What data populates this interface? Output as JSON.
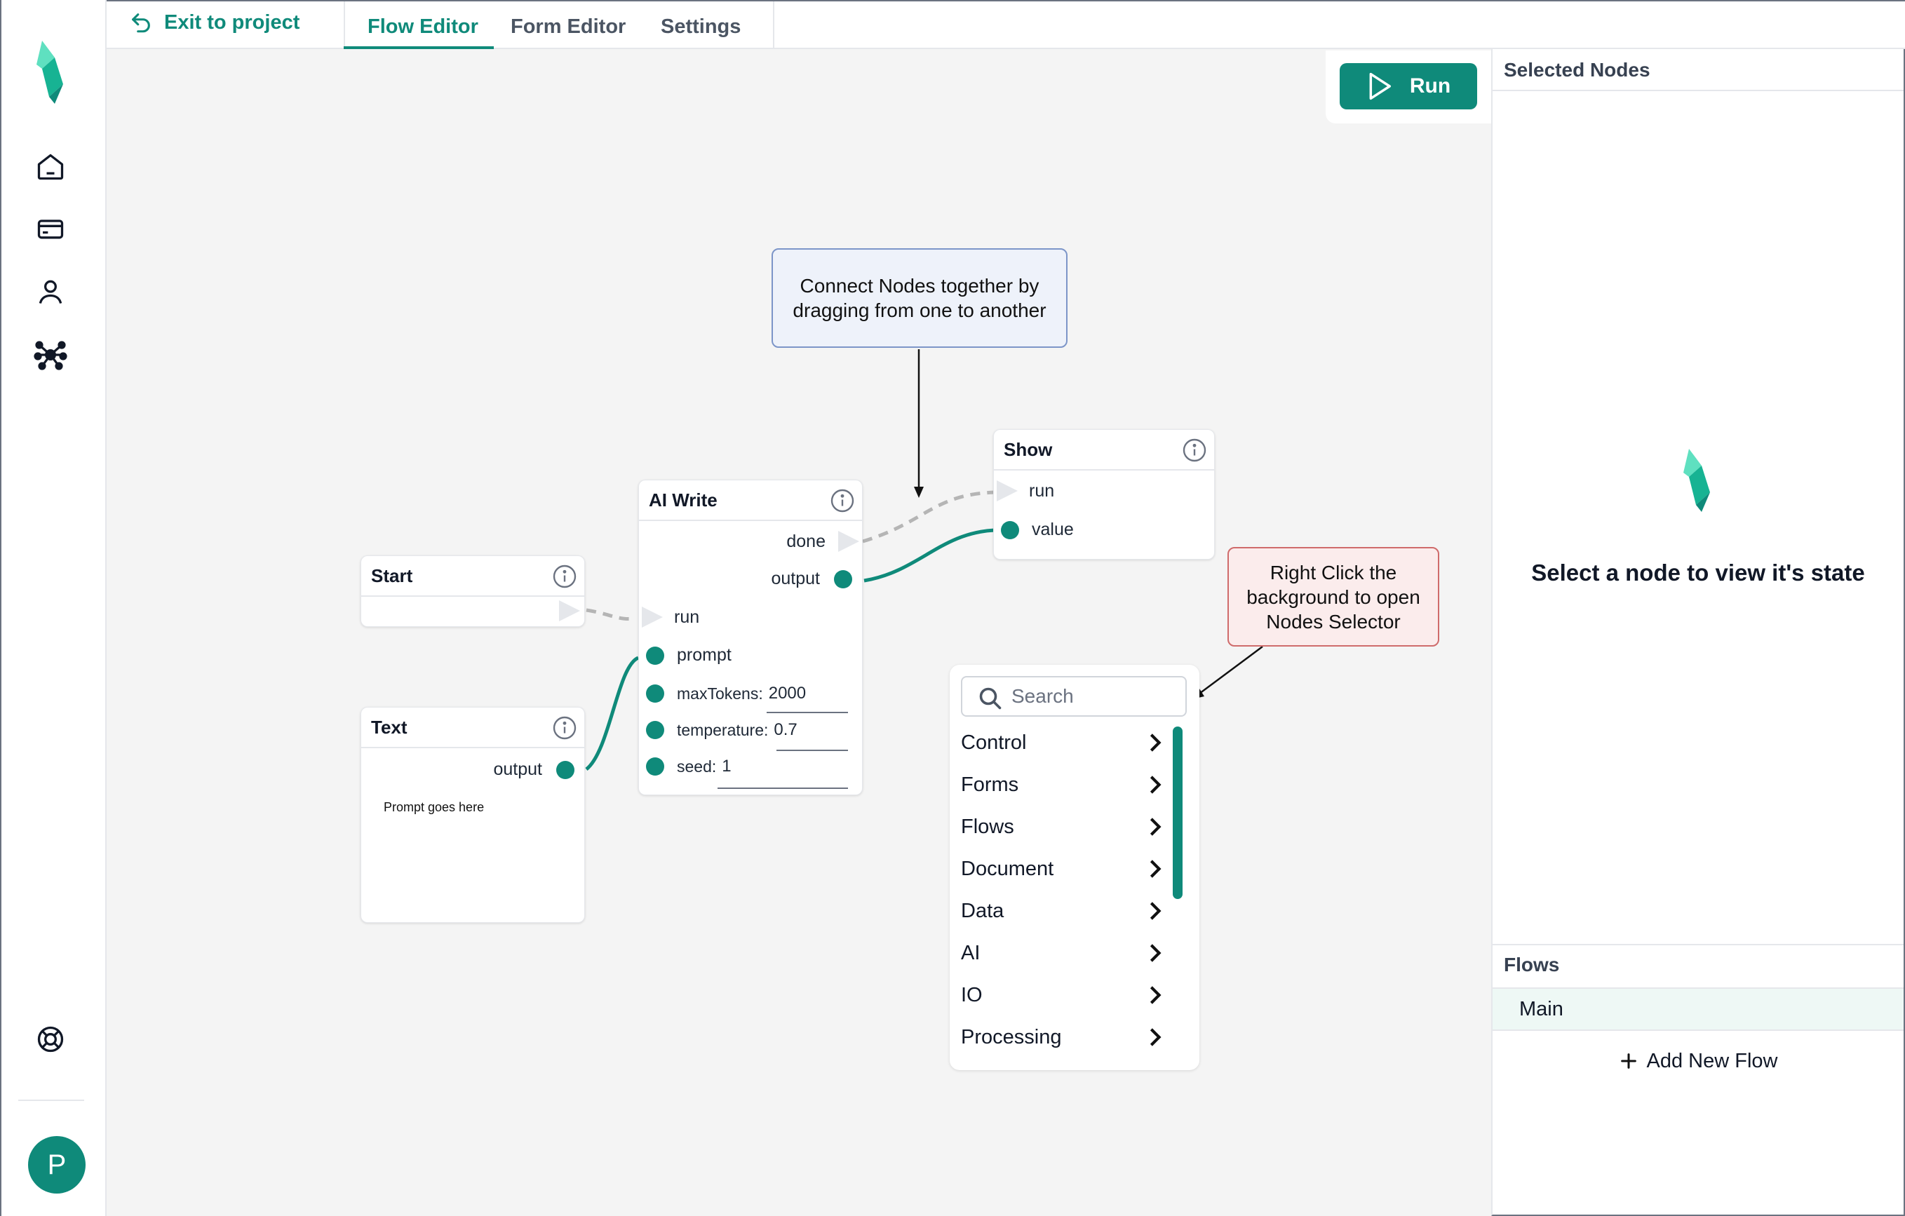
{
  "colors": {
    "accent": "#0f8a7a",
    "rail_border": "#e5e7eb",
    "note_blue": "#eef2fa",
    "note_red": "#fbecec"
  },
  "rail": {
    "icons": [
      "logo-icon",
      "home-icon",
      "card-icon",
      "user-icon",
      "nodes-icon",
      "help-icon"
    ],
    "avatar_initial": "P"
  },
  "topbar": {
    "exit_label": "Exit to project",
    "tabs": [
      {
        "label": "Flow Editor",
        "active": true
      },
      {
        "label": "Form Editor",
        "active": false
      },
      {
        "label": "Settings",
        "active": false
      }
    ]
  },
  "run_button": {
    "label": "Run"
  },
  "notes": {
    "connect": "Connect Nodes together by dragging from one to another",
    "right_click": "Right Click the background to open Nodes Selector"
  },
  "nodes": {
    "start": {
      "title": "Start"
    },
    "text": {
      "title": "Text",
      "output_label": "output",
      "content": "Prompt goes here"
    },
    "ai_write": {
      "title": "AI Write",
      "done_label": "done",
      "output_label": "output",
      "run_label": "run",
      "prompt_label": "prompt",
      "max_tokens_label": "maxTokens:",
      "max_tokens_value": "2000",
      "temperature_label": "temperature:",
      "temperature_value": "0.7",
      "seed_label": "seed:",
      "seed_value": "1"
    },
    "show": {
      "title": "Show",
      "run_label": "run",
      "value_label": "value"
    }
  },
  "selector": {
    "search_placeholder": "Search",
    "categories": [
      "Control",
      "Forms",
      "Flows",
      "Document",
      "Data",
      "AI",
      "IO",
      "Processing"
    ]
  },
  "right_panel": {
    "title": "Selected Nodes",
    "empty_message": "Select a node to view it's state",
    "flows_title": "Flows",
    "flows": [
      "Main"
    ],
    "add_flow_label": "Add New Flow"
  }
}
